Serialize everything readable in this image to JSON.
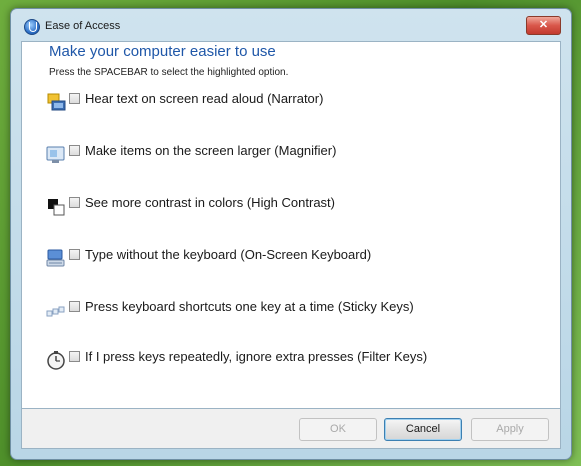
{
  "window": {
    "title": "Ease of Access",
    "close_glyph": "✕"
  },
  "main": {
    "heading": "Make your computer easier to use",
    "instruction": "Press the SPACEBAR to select the highlighted option."
  },
  "options": [
    {
      "label": "Hear text on screen read aloud (Narrator)",
      "icon": "narrator-icon",
      "checked": false
    },
    {
      "label": "Make items on the screen larger (Magnifier)",
      "icon": "magnifier-icon",
      "checked": false
    },
    {
      "label": "See more contrast in colors (High Contrast)",
      "icon": "high-contrast-icon",
      "checked": false
    },
    {
      "label": "Type without the keyboard (On-Screen Keyboard)",
      "icon": "onscreen-keyboard-icon",
      "checked": false
    },
    {
      "label": "Press keyboard shortcuts one key at a time (Sticky Keys)",
      "icon": "sticky-keys-icon",
      "checked": false
    },
    {
      "label": "If I press keys repeatedly, ignore extra presses (Filter Keys)",
      "icon": "filter-keys-icon",
      "checked": false
    }
  ],
  "buttons": {
    "ok": "OK",
    "cancel": "Cancel",
    "apply": "Apply"
  },
  "colors": {
    "heading": "#1f57a8",
    "close_button": "#d9564a"
  }
}
